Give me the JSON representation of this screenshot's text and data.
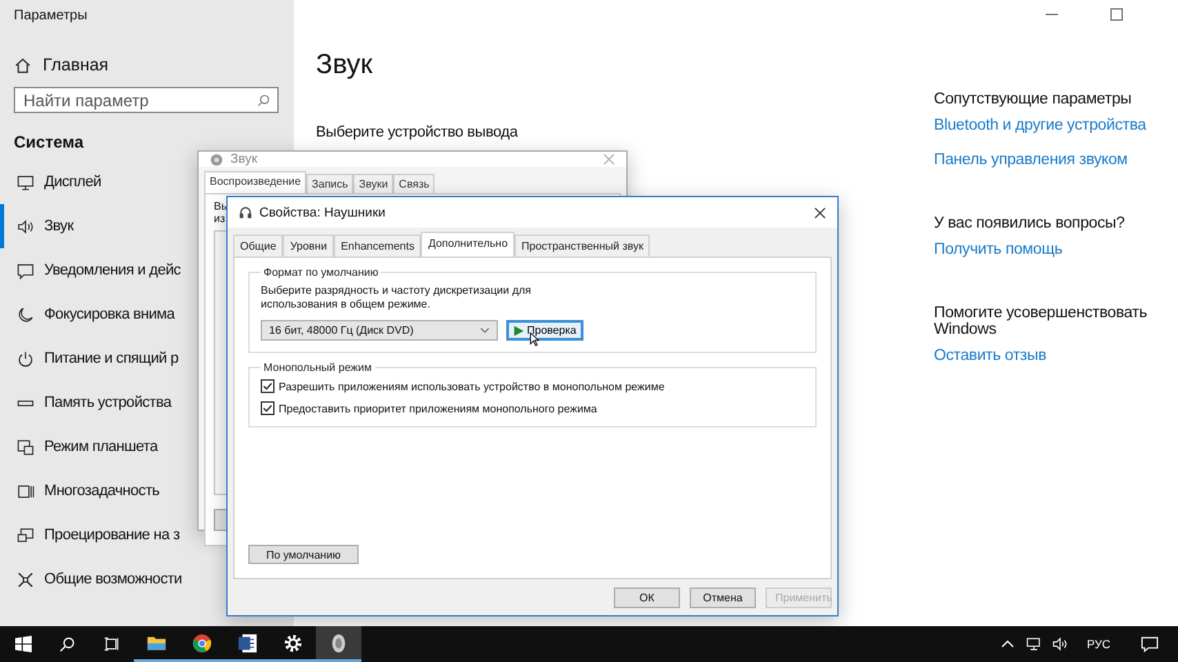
{
  "settings_window": {
    "title": "Параметры",
    "home": "Главная",
    "search": {
      "placeholder": "Найти параметр"
    },
    "section": "Система",
    "items": [
      {
        "label": "Дисплей",
        "selected": false
      },
      {
        "label": "Звук",
        "selected": true
      },
      {
        "label": "Уведомления и дейс",
        "selected": false
      },
      {
        "label": "Фокусировка внима",
        "selected": false
      },
      {
        "label": "Питание и спящий р",
        "selected": false
      },
      {
        "label": "Память устройства",
        "selected": false
      },
      {
        "label": "Режим планшета",
        "selected": false
      },
      {
        "label": "Многозадачность",
        "selected": false
      },
      {
        "label": "Проецирование на з",
        "selected": false
      },
      {
        "label": "Общие возможности",
        "selected": false
      }
    ],
    "heading": "Звук",
    "subheading": "Выберите устройство вывода",
    "sections": [
      {
        "title": "Сопутствующие параметры",
        "links": [
          "Bluetooth и другие устройства",
          "Панель управления звуком"
        ]
      },
      {
        "title": "У вас появились вопросы?",
        "links": [
          "Получить помощь"
        ]
      },
      {
        "title": "Помогите усовершенствовать Windows",
        "links": [
          "Оставить отзыв"
        ]
      }
    ]
  },
  "sound_dialog": {
    "title": "Звук",
    "tabs": [
      {
        "label": "Воспроизведение",
        "selected": true
      },
      {
        "label": "Запись",
        "selected": false
      },
      {
        "label": "Звуки",
        "selected": false
      },
      {
        "label": "Связь",
        "selected": false
      }
    ],
    "text_fragments": [
      "Вы",
      "из"
    ]
  },
  "properties_dialog": {
    "title": "Свойства: Наушники",
    "tabs": [
      {
        "label": "Общие",
        "selected": false
      },
      {
        "label": "Уровни",
        "selected": false
      },
      {
        "label": "Enhancements",
        "selected": false
      },
      {
        "label": "Дополнительно",
        "selected": true
      },
      {
        "label": "Пространственный звук",
        "selected": false
      }
    ],
    "format_group": {
      "title": "Формат по умолчанию",
      "description": "Выберите разрядность и частоту дискретизации для использования в общем режиме.",
      "format": "16 бит, 48000 Гц (Диск DVD)",
      "test_button": {
        "label": "Проверка",
        "focused": true
      }
    },
    "exclusive_group": {
      "title": "Монопольный режим",
      "options": [
        {
          "label": "Разрешить приложениям использовать устройство в монопольном режиме",
          "checked": true
        },
        {
          "label": "Предоставить приоритет приложениям монопольного режима",
          "checked": true
        }
      ]
    },
    "defaults_button": "По умолчанию",
    "buttons": [
      {
        "label": "ОК",
        "disabled": false
      },
      {
        "label": "Отмена",
        "disabled": false
      },
      {
        "label": "Применить",
        "disabled": true
      }
    ]
  },
  "taskbar": {
    "apps": [
      {
        "running": true,
        "active": false
      },
      {
        "running": true,
        "active": false
      },
      {
        "running": true,
        "active": false
      },
      {
        "running": true,
        "active": false
      },
      {
        "running": true,
        "active": true
      }
    ],
    "language": "РУС"
  }
}
